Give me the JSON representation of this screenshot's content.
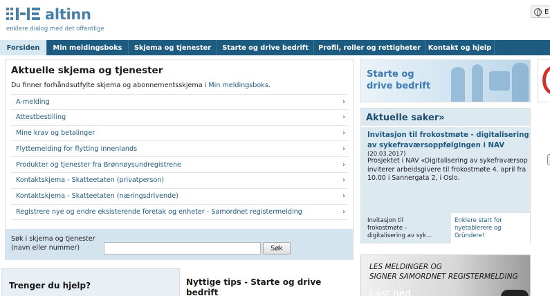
{
  "header": {
    "logo_text": "altinn",
    "tagline": "enklere dialog med det offentlige",
    "language_label": "E"
  },
  "nav": {
    "items": [
      {
        "label": "Forsiden",
        "active": true
      },
      {
        "label": "Min meldingsboks",
        "active": false
      },
      {
        "label": "Skjema og tjenester",
        "active": false
      },
      {
        "label": "Starte og drive bedrift",
        "active": false
      },
      {
        "label": "Profil, roller og rettigheter",
        "active": false
      },
      {
        "label": "Kontakt og hjelp",
        "active": false
      }
    ]
  },
  "main": {
    "title": "Aktuelle skjema og tjenester",
    "intro_text": "Du finner forhåndsutfylte skjema og abonnementsskjema i ",
    "intro_link": "Min meldingsboks",
    "intro_end": ".",
    "services": [
      "A-melding",
      "Attestbestilling",
      "Mine krav og betalinger",
      "Flyttemelding for flytting innenlands",
      "Produkter og tjenester fra Brønnøysundregistrene",
      "Kontaktskjema - Skatteetaten (privatperson)",
      "Kontaktskjema - Skatteetaten (næringsdrivende)",
      "Registrere nye og endre eksisterende foretak og enheter - Samordnet registermelding"
    ],
    "search": {
      "label_line1": "Søk i skjema og tjenester",
      "label_line2": "(navn eller nummer)",
      "value": "",
      "button": "Søk"
    }
  },
  "help": {
    "title": "Trenger du hjelp?"
  },
  "tips": {
    "title": "Nyttige tips - Starte og drive bedrift"
  },
  "banner": {
    "text": "Starte og drive bedrift"
  },
  "news": {
    "heading": "Aktuelle saker»",
    "link": "Invitasjon til frokostmøte - digitalisering av sykefraværsoppfølgingen i NAV",
    "date": "(20.03.2017)",
    "body": "Prosjektet i NAV «Digitalisering av sykefraværsop\ninviterer arbeidsgivere til frokostmøte 4. april fra\n10.00 i Sannergata 2, i Oslo.",
    "footer_left": "Invitasjon til\nfrokostmøte -\ndigitalisering av syk...",
    "footer_right": "Enklere start for\nnyetablerere og\nGründere!"
  },
  "ad": {
    "text": "LES MELDINGER OG\nSIGNER SAMORDNET REGISTERMELDING",
    "script": "Last ned"
  },
  "colors": {
    "nav_bg": "#1e5b80",
    "brand": "#4a7fa8",
    "link": "#1e5b80",
    "panel_bg": "#dde9f1"
  }
}
